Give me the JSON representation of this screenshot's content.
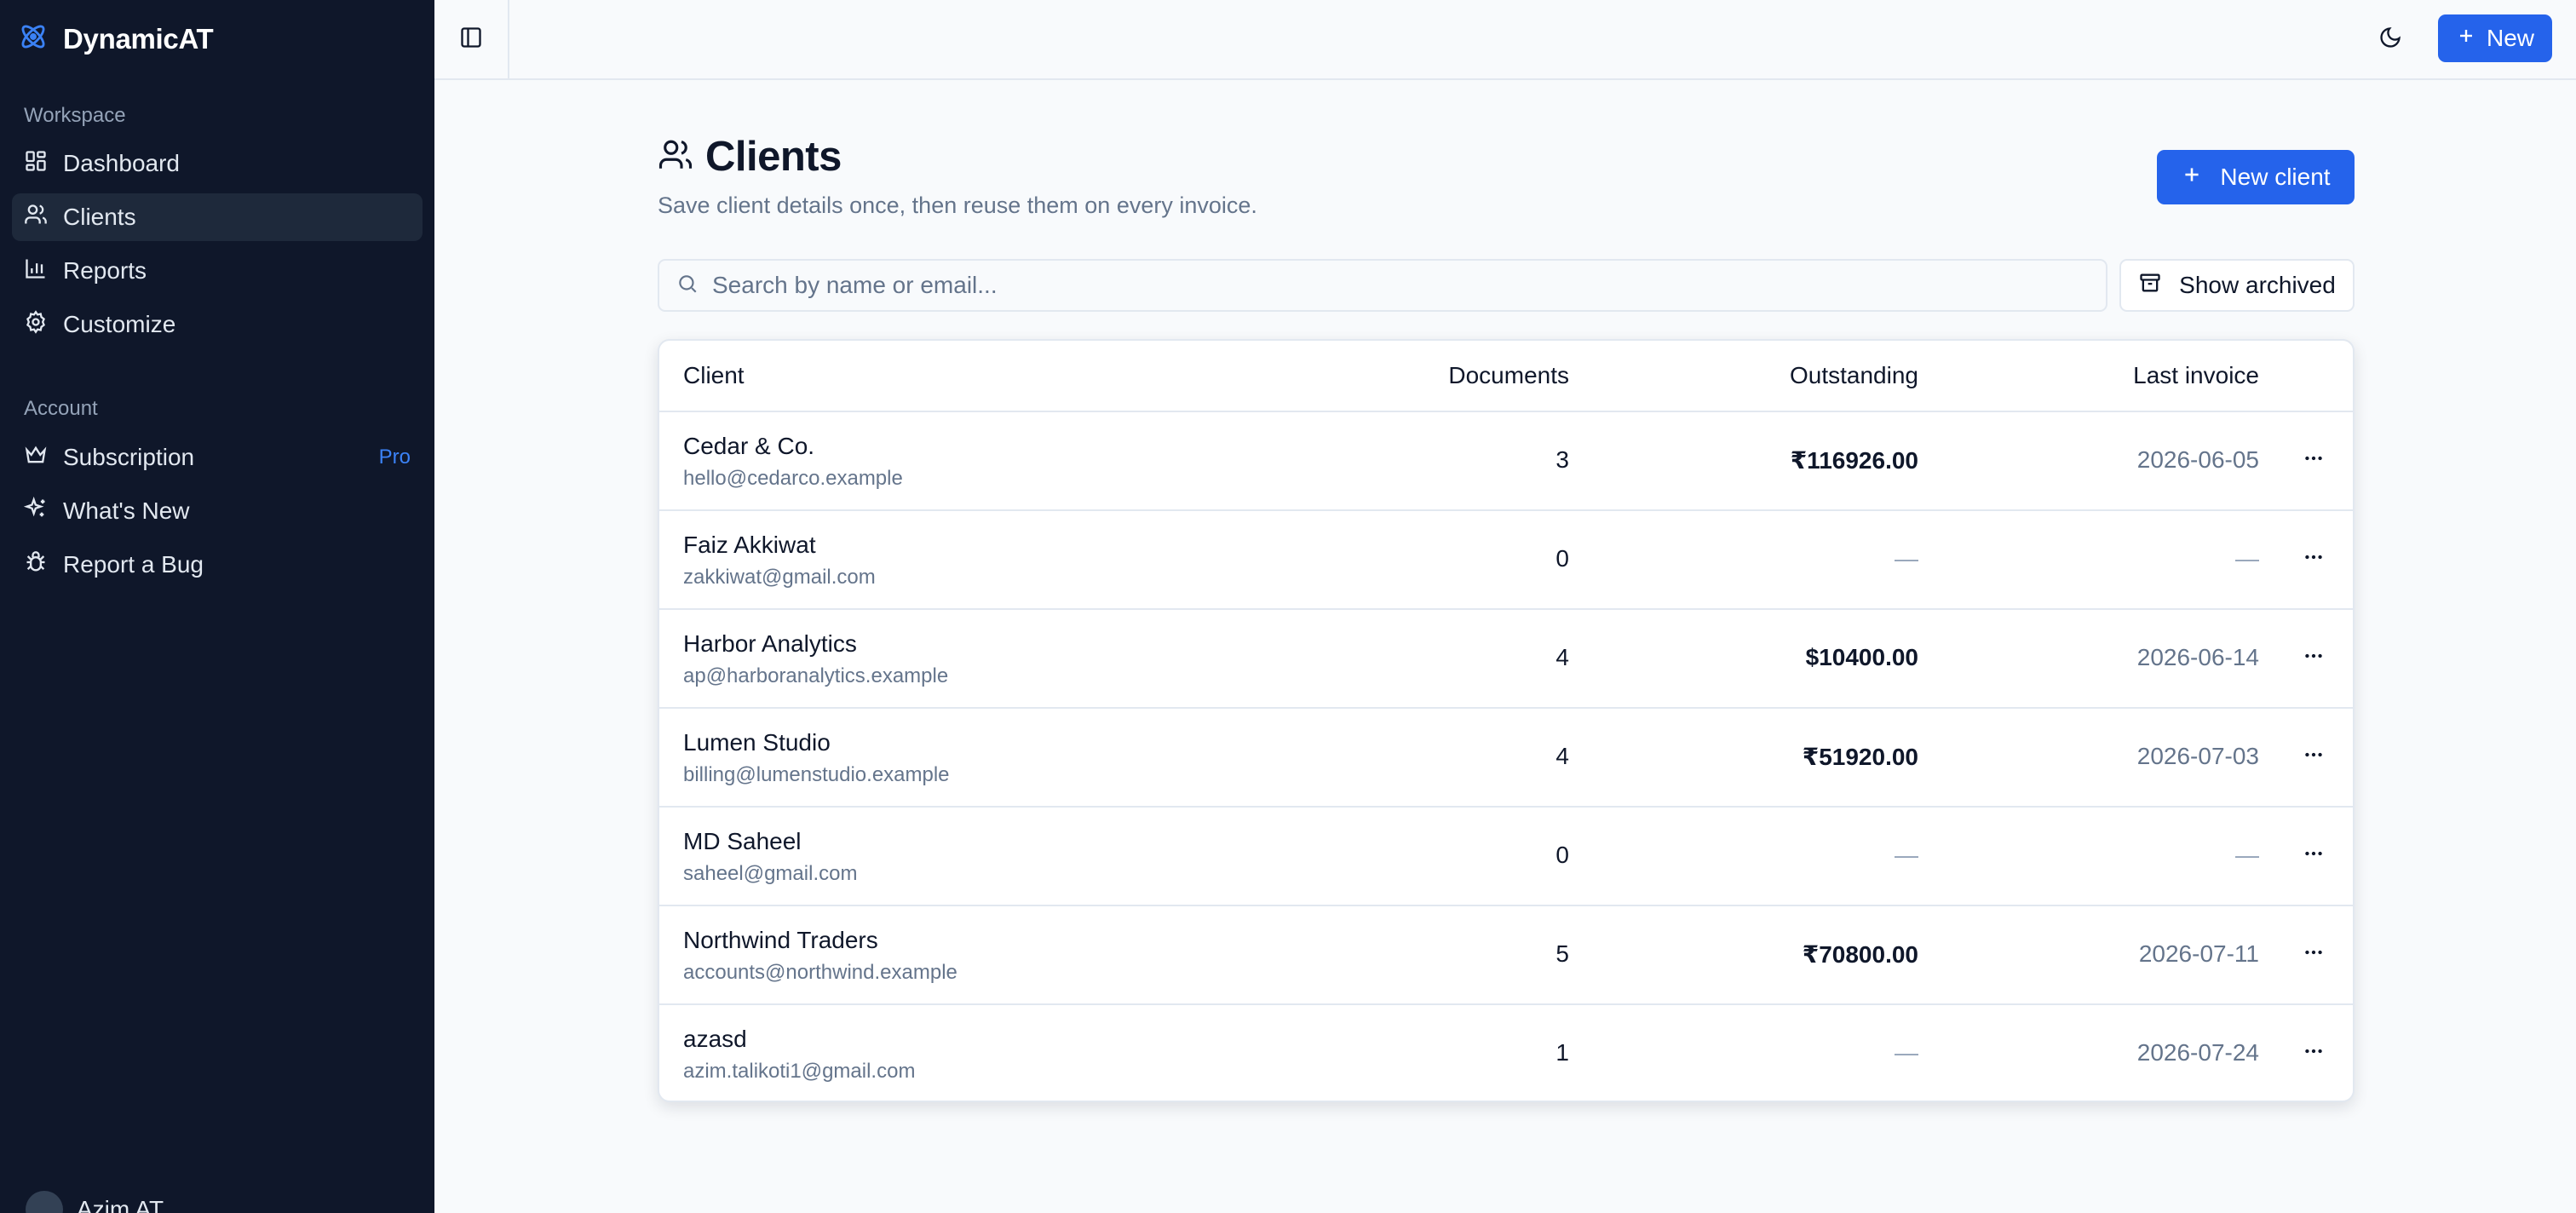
{
  "app": {
    "name": "DynamicAT"
  },
  "sidebar": {
    "workspace_label": "Workspace",
    "workspace_items": [
      {
        "label": "Dashboard",
        "icon": "dashboard-icon"
      },
      {
        "label": "Clients",
        "icon": "users-icon",
        "active": true
      },
      {
        "label": "Reports",
        "icon": "bar-chart-icon"
      },
      {
        "label": "Customize",
        "icon": "gear-icon"
      }
    ],
    "account_label": "Account",
    "account_items": [
      {
        "label": "Subscription",
        "icon": "crown-icon",
        "badge": "Pro"
      },
      {
        "label": "What's New",
        "icon": "sparkles-icon"
      },
      {
        "label": "Report a Bug",
        "icon": "bug-icon"
      }
    ],
    "user_name": "Azim AT"
  },
  "topbar": {
    "new_label": "New"
  },
  "page": {
    "title": "Clients",
    "subtitle": "Save client details once, then reuse them on every invoice.",
    "new_client_label": "New client",
    "search_placeholder": "Search by name or email...",
    "show_archived_label": "Show archived"
  },
  "table": {
    "columns": {
      "client": "Client",
      "documents": "Documents",
      "outstanding": "Outstanding",
      "last_invoice": "Last invoice"
    },
    "rows": [
      {
        "name": "Cedar & Co.",
        "email": "hello@cedarco.example",
        "documents": "3",
        "outstanding": "₹116926.00",
        "last_invoice": "2026-06-05"
      },
      {
        "name": "Faiz Akkiwat",
        "email": "zakkiwat@gmail.com",
        "documents": "0",
        "outstanding": "—",
        "last_invoice": "—"
      },
      {
        "name": "Harbor Analytics",
        "email": "ap@harboranalytics.example",
        "documents": "4",
        "outstanding": "$10400.00",
        "last_invoice": "2026-06-14"
      },
      {
        "name": "Lumen Studio",
        "email": "billing@lumenstudio.example",
        "documents": "4",
        "outstanding": "₹51920.00",
        "last_invoice": "2026-07-03"
      },
      {
        "name": "MD Saheel",
        "email": "saheel@gmail.com",
        "documents": "0",
        "outstanding": "—",
        "last_invoice": "—"
      },
      {
        "name": "Northwind Traders",
        "email": "accounts@northwind.example",
        "documents": "5",
        "outstanding": "₹70800.00",
        "last_invoice": "2026-07-11"
      },
      {
        "name": "azasd",
        "email": "azim.talikoti1@gmail.com",
        "documents": "1",
        "outstanding": "—",
        "last_invoice": "2026-07-24"
      }
    ]
  },
  "colors": {
    "sidebar_bg": "#0f172a",
    "accent": "#2563eb",
    "pro_badge": "#3b82f6",
    "page_bg": "#f8fafc"
  }
}
